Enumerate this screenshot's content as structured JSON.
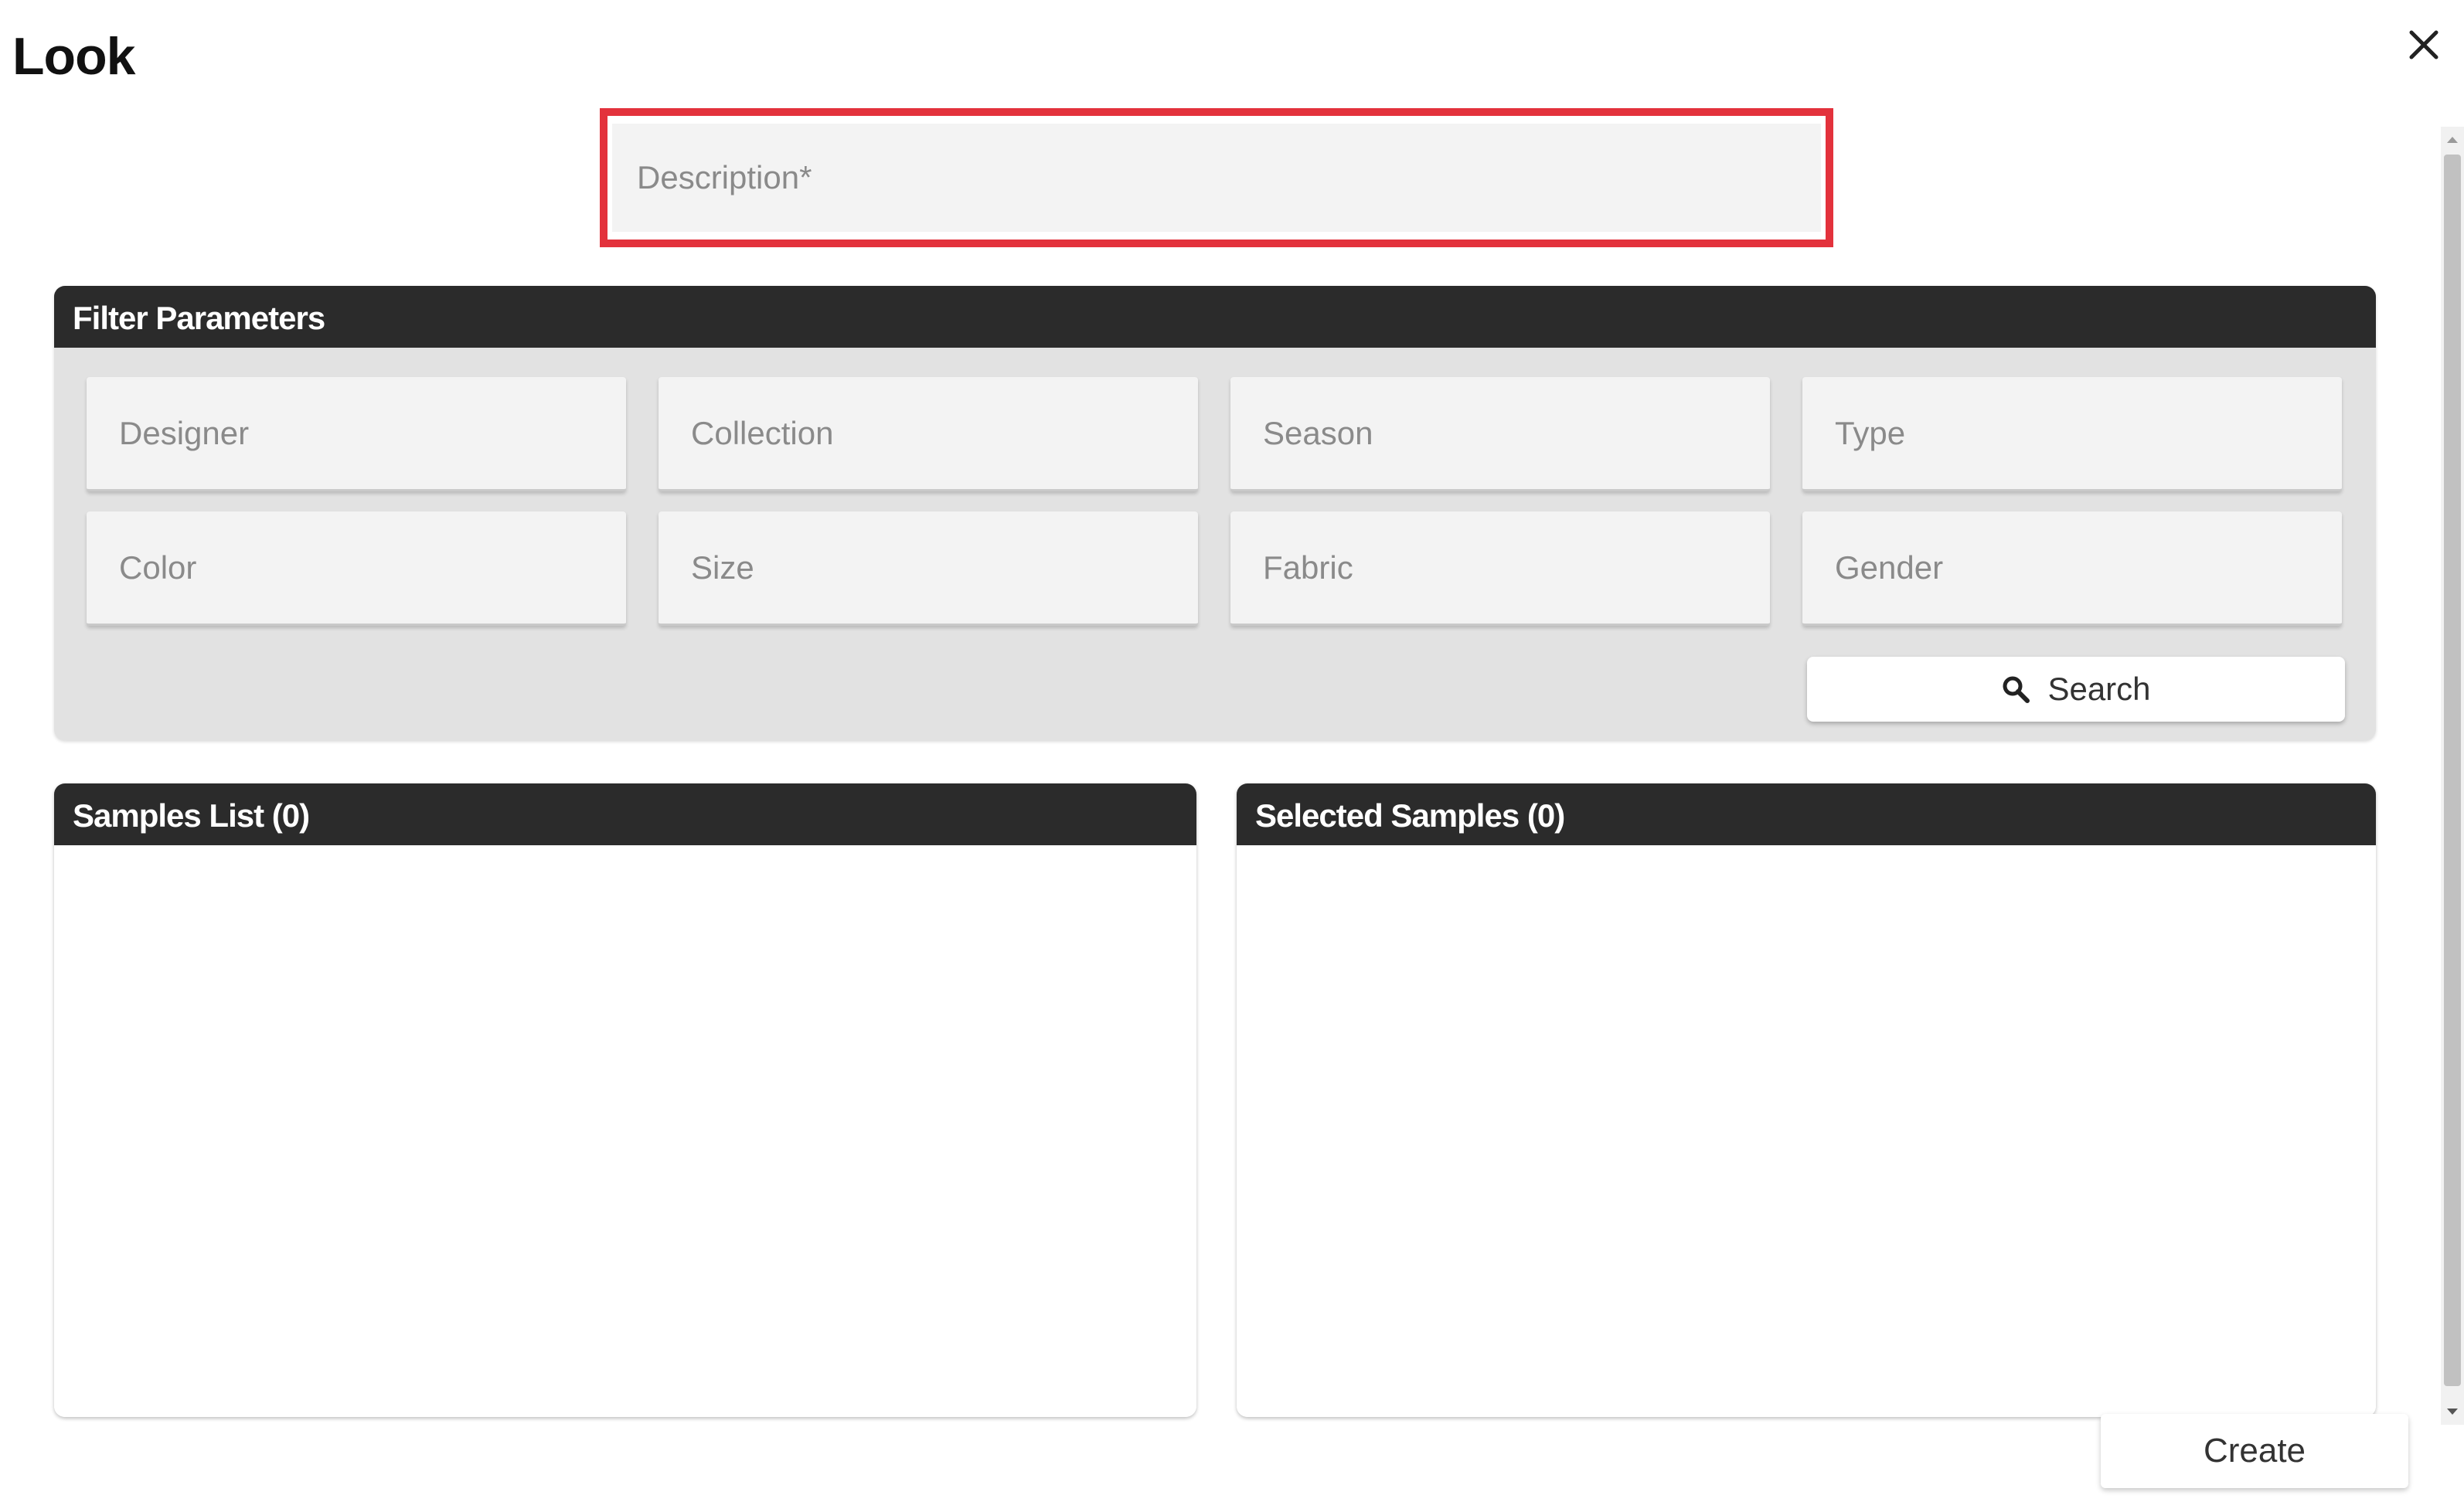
{
  "dialog": {
    "title": "Look",
    "close_icon": "close-icon"
  },
  "description": {
    "placeholder": "Description*",
    "value": "",
    "highlight_color": "#e3323c"
  },
  "filter": {
    "header": "Filter Parameters",
    "fields": [
      {
        "placeholder": "Designer"
      },
      {
        "placeholder": "Collection"
      },
      {
        "placeholder": "Season"
      },
      {
        "placeholder": "Type"
      },
      {
        "placeholder": "Color"
      },
      {
        "placeholder": "Size"
      },
      {
        "placeholder": "Fabric"
      },
      {
        "placeholder": "Gender"
      }
    ],
    "search_label": "Search",
    "search_icon": "search-icon"
  },
  "samples_list": {
    "header": "Samples List (0)"
  },
  "selected_samples": {
    "header": "Selected Samples (0)"
  },
  "footer": {
    "create_label": "Create"
  },
  "colors": {
    "header_bg": "#2b2b2b",
    "panel_bg": "#e2e2e2",
    "field_bg": "#f3f3f3"
  }
}
